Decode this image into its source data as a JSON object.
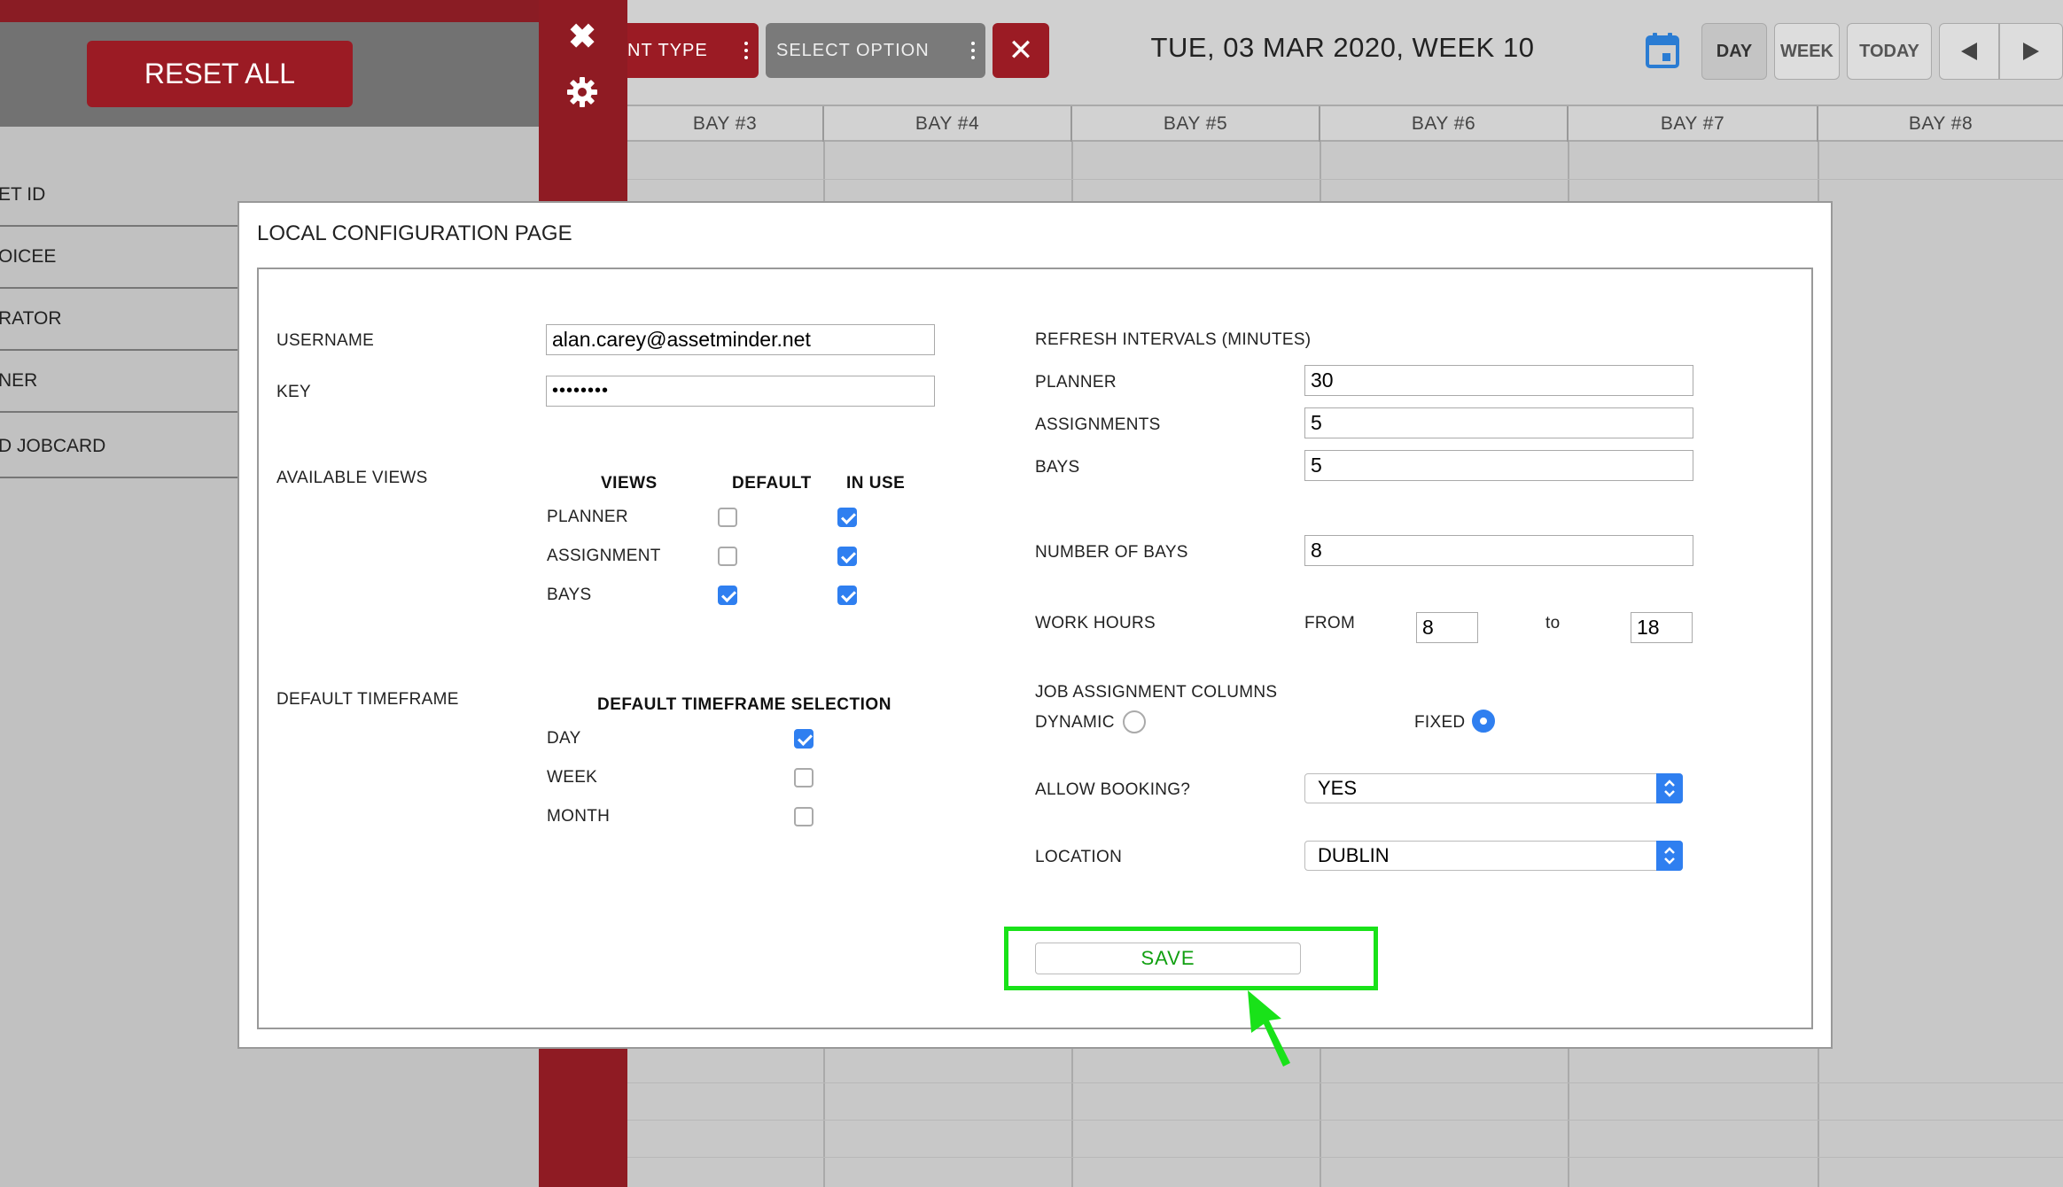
{
  "left_panel": {
    "reset_label": "RESET ALL",
    "items": [
      "ET ID",
      "OICEE",
      "RATOR",
      "NER",
      "D JOBCARD"
    ]
  },
  "toolbar": {
    "filter1_label": "NT TYPE",
    "filter2_label": "SELECT OPTION",
    "date_label": "TUE, 03 MAR 2020, WEEK 10",
    "day_label": "DAY",
    "week_label": "WEEK",
    "today_label": "TODAY",
    "accent_color": "#9b1b24"
  },
  "bays": [
    "BAY #3",
    "BAY #4",
    "BAY #5",
    "BAY #6",
    "BAY #7",
    "BAY #8"
  ],
  "modal": {
    "title": "LOCAL CONFIGURATION PAGE",
    "username_label": "USERNAME",
    "username_value": "alan.carey@assetminder.net",
    "key_label": "KEY",
    "key_value": "••••••••",
    "available_views_label": "AVAILABLE VIEWS",
    "views_header": "VIEWS",
    "default_header": "DEFAULT",
    "in_use_header": "IN USE",
    "views": [
      {
        "name": "PLANNER",
        "default": false,
        "in_use": true
      },
      {
        "name": "ASSIGNMENT",
        "default": false,
        "in_use": true
      },
      {
        "name": "BAYS",
        "default": true,
        "in_use": true
      }
    ],
    "default_timeframe_label": "DEFAULT TIMEFRAME",
    "timeframe_header": "DEFAULT TIMEFRAME SELECTION",
    "timeframes": [
      {
        "name": "DAY",
        "checked": true
      },
      {
        "name": "WEEK",
        "checked": false
      },
      {
        "name": "MONTH",
        "checked": false
      }
    ],
    "refresh_label": "REFRESH INTERVALS (MINUTES)",
    "planner_label": "PLANNER",
    "planner_value": "30",
    "assignments_label": "ASSIGNMENTS",
    "assignments_value": "5",
    "bays_label": "BAYS",
    "bays_value": "5",
    "num_bays_label": "NUMBER OF BAYS",
    "num_bays_value": "8",
    "work_hours_label": "WORK HOURS",
    "from_label": "FROM",
    "from_value": "8",
    "to_label": "to",
    "to_value": "18",
    "job_columns_label": "JOB ASSIGNMENT COLUMNS",
    "dynamic_label": "DYNAMIC",
    "fixed_label": "FIXED",
    "job_columns_selected": "FIXED",
    "allow_booking_label": "ALLOW BOOKING?",
    "allow_booking_value": "YES",
    "location_label": "LOCATION",
    "location_value": "DUBLIN",
    "save_label": "SAVE",
    "highlight_color": "#19e219"
  }
}
